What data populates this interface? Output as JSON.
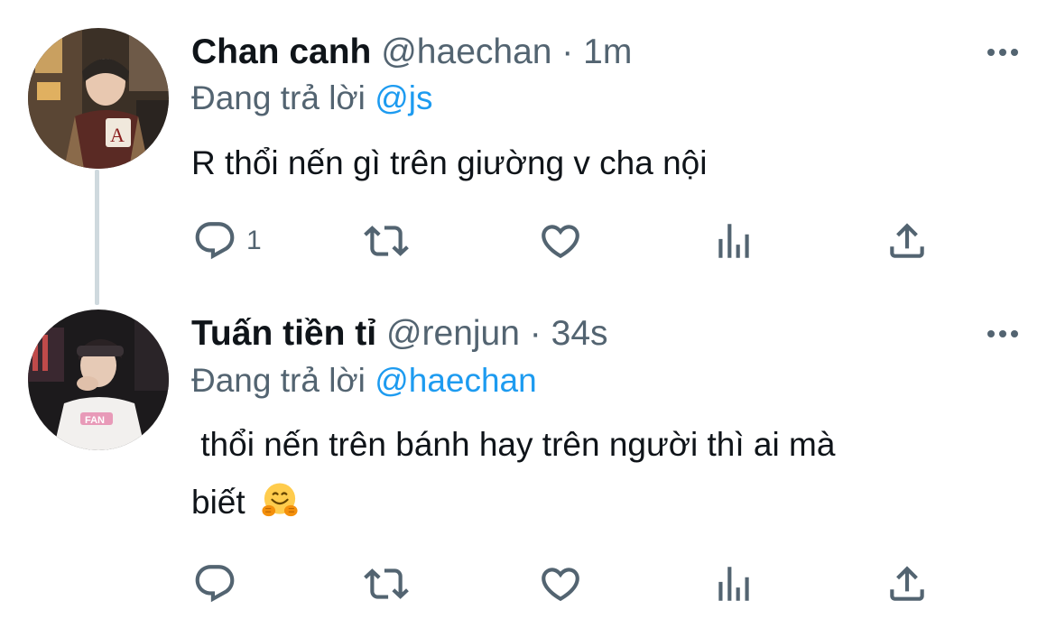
{
  "colors": {
    "text_primary": "#0f1419",
    "text_secondary": "#536471",
    "mention": "#1d9bf0",
    "thread_line": "#cfd9de"
  },
  "tweets": [
    {
      "name": "Chan canh",
      "handle": "@haechan",
      "separator": "·",
      "time": "1m",
      "replying_label": "Đang trả lời",
      "replying_to": "@js",
      "text": "R thổi nến gì trên giường v cha nội",
      "reply_count": "1",
      "icons": [
        "reply-icon",
        "retweet-icon",
        "like-icon",
        "analytics-icon",
        "share-icon",
        "more-icon"
      ]
    },
    {
      "name": "Tuấn tiền tỉ",
      "handle": "@renjun",
      "separator": "·",
      "time": "34s",
      "replying_label": "Đang trả lời",
      "replying_to": "@haechan",
      "text_line1": " thổi nến trên bánh hay trên người thì ai mà",
      "text_line2": "biết",
      "emoji": "hugging-face-emoji",
      "reply_count": "",
      "icons": [
        "reply-icon",
        "retweet-icon",
        "like-icon",
        "analytics-icon",
        "share-icon",
        "more-icon"
      ]
    }
  ]
}
